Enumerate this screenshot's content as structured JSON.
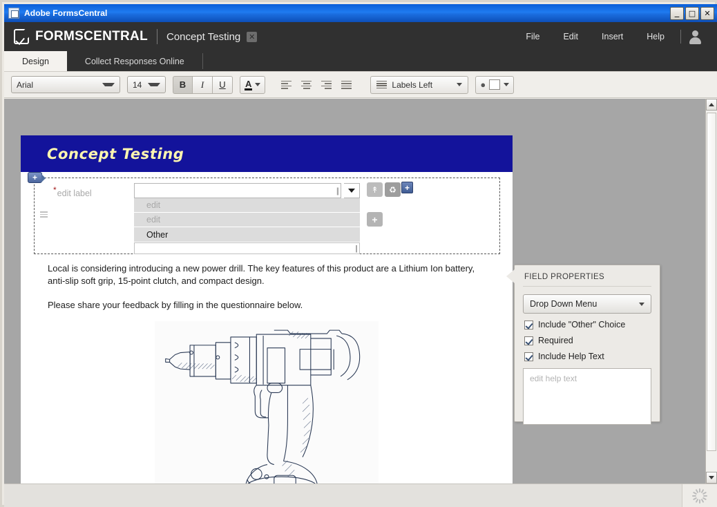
{
  "window": {
    "title": "Adobe FormsCentral",
    "icon": "document-icon",
    "controls": [
      {
        "name": "minimize-button",
        "glyph": "_"
      },
      {
        "name": "maximize-button",
        "glyph": "□"
      },
      {
        "name": "close-button",
        "glyph": "✕"
      }
    ]
  },
  "brandbar": {
    "logo_icon": "formscentral-logo-icon",
    "brand": "FORMSCENTRAL",
    "doc_title": "Concept Testing",
    "close_glyph": "✕",
    "menus": [
      "File",
      "Edit",
      "Insert",
      "Help"
    ],
    "avatar_icon": "user-avatar-icon"
  },
  "tabs": [
    {
      "label": "Design",
      "active": true
    },
    {
      "label": "Collect Responses Online",
      "active": false
    }
  ],
  "toolbar": {
    "font_family": "Arial",
    "font_size": "14",
    "bold": "B",
    "italic": "I",
    "underline": "U",
    "text_color_letter": "A",
    "align_left": "align-left-icon",
    "align_center": "align-center-icon",
    "align_right": "align-right-icon",
    "align_justify": "align-justify-icon",
    "labels_position": "Labels Left",
    "fill_bucket_icon": "paint-bucket-icon",
    "fill_color": "#ffffff"
  },
  "form": {
    "header_title": "Concept Testing",
    "header_bg": "#13139b",
    "header_text_color": "#fdf6b0",
    "field": {
      "label": "edit label",
      "required_marker": "*",
      "dropdown_value": "",
      "options": [
        {
          "text": "edit",
          "placeholder": true
        },
        {
          "text": "edit",
          "placeholder": true
        },
        {
          "text": "Other",
          "placeholder": false
        }
      ],
      "new_option_value": "",
      "tag_glyph": "+",
      "move_icon": "move-to-top-icon",
      "delete_icon": "trash-icon",
      "add_option_glyph": "+",
      "add_field_glyph": "+"
    },
    "paragraph_1": "Local is considering introducing a new power drill. The key features of this product are a Lithium Ion battery, anti-slip soft grip, 15-point clutch, and compact design.",
    "paragraph_2": "Please share your feedback by filling in the questionnaire below.",
    "image_alt": "power-drill-line-drawing"
  },
  "properties": {
    "title": "FIELD PROPERTIES",
    "field_type": "Drop Down Menu",
    "checkboxes": [
      {
        "label": "Include \"Other\" Choice",
        "checked": true
      },
      {
        "label": "Required",
        "checked": true
      },
      {
        "label": "Include Help Text",
        "checked": true
      }
    ],
    "help_placeholder": "edit help text"
  },
  "status": {
    "spinner_icon": "loading-spinner-icon"
  }
}
